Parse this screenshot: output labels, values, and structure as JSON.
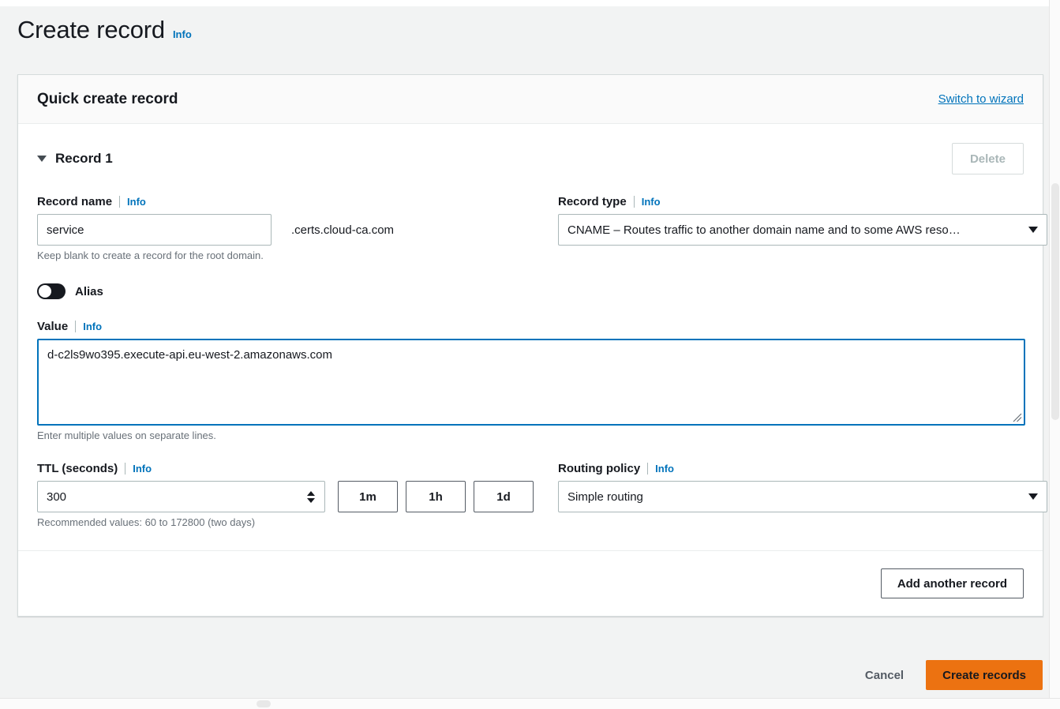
{
  "page": {
    "title": "Create record",
    "info_label": "Info"
  },
  "card": {
    "heading": "Quick create record",
    "switch_link": "Switch to wizard"
  },
  "record": {
    "title": "Record 1",
    "delete_label": "Delete",
    "record_name": {
      "label": "Record name",
      "info_label": "Info",
      "value": "service",
      "placeholder": "",
      "suffix": ".certs.cloud-ca.com",
      "help": "Keep blank to create a record for the root domain."
    },
    "record_type": {
      "label": "Record type",
      "info_label": "Info",
      "selected": "CNAME – Routes traffic to another domain name and to some AWS reso…"
    },
    "alias": {
      "label": "Alias",
      "enabled": "false"
    },
    "value": {
      "label": "Value",
      "info_label": "Info",
      "text": "d-c2ls9wo395.execute-api.eu-west-2.amazonaws.com",
      "placeholder": "",
      "help": "Enter multiple values on separate lines."
    },
    "ttl": {
      "label": "TTL (seconds)",
      "info_label": "Info",
      "value": "300",
      "help": "Recommended values: 60 to 172800 (two days)",
      "quick_buttons": [
        "1m",
        "1h",
        "1d"
      ]
    },
    "routing_policy": {
      "label": "Routing policy",
      "info_label": "Info",
      "selected": "Simple routing"
    }
  },
  "actions": {
    "add_another": "Add another record",
    "cancel": "Cancel",
    "create": "Create records"
  },
  "colors": {
    "accent_orange": "#ec7211",
    "link_blue": "#0073bb",
    "focus_blue": "#0073bb",
    "text": "#16191f",
    "muted_text": "#687078",
    "border": "#aab7b8",
    "page_bg": "#f2f3f3"
  }
}
